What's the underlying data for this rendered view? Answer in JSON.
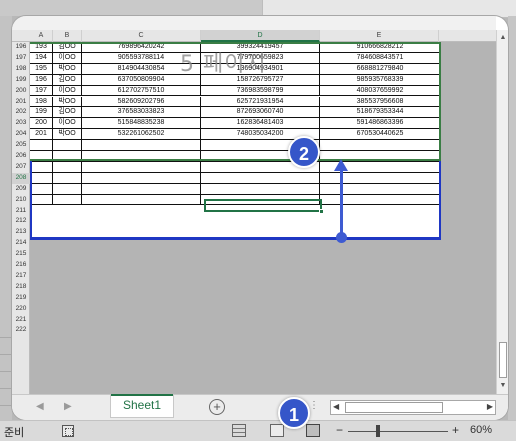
{
  "columns": [
    "A",
    "B",
    "C",
    "D",
    "E"
  ],
  "watermark": "5 페이지",
  "data_rows": [
    {
      "row": "196",
      "a": "193",
      "b": "김OO",
      "c": "769896420242",
      "d": "399324419457",
      "e": "910666828212"
    },
    {
      "row": "197",
      "a": "194",
      "b": "이OO",
      "c": "905593788114",
      "d": "779700659823",
      "e": "784608843571"
    },
    {
      "row": "198",
      "a": "195",
      "b": "박OO",
      "c": "814904430854",
      "d": "136904934901",
      "e": "668881279840"
    },
    {
      "row": "199",
      "a": "196",
      "b": "김OO",
      "c": "637050809904",
      "d": "158726795727",
      "e": "985935768339"
    },
    {
      "row": "200",
      "a": "197",
      "b": "이OO",
      "c": "612702757510",
      "d": "736983598799",
      "e": "408037659992"
    },
    {
      "row": "201",
      "b": "박OO",
      "a": "198",
      "c": "582609202796",
      "d": "625721931954",
      "e": "385537956608"
    },
    {
      "row": "202",
      "a": "199",
      "b": "김OO",
      "c": "376583033823",
      "d": "872693060740",
      "e": "518679353344"
    },
    {
      "row": "203",
      "a": "200",
      "b": "이OO",
      "c": "515848835238",
      "d": "162836481403",
      "e": "591486863396"
    },
    {
      "row": "204",
      "a": "201",
      "b": "박OO",
      "c": "532261062502",
      "d": "748035034200",
      "e": "670530440625"
    }
  ],
  "empty_rows": [
    "205",
    "206",
    "207",
    "208",
    "209",
    "210"
  ],
  "gray_rows": [
    "211",
    "212",
    "213",
    "214",
    "215",
    "216",
    "217",
    "218",
    "219",
    "220",
    "221",
    "222"
  ],
  "active_row": "208",
  "active_column": "D",
  "sheet_tab": "Sheet1",
  "status": {
    "ready_text": "준비",
    "zoom": "60%"
  },
  "badges": {
    "one": "1",
    "two": "2"
  },
  "colors": {
    "excel_green": "#217346",
    "print_area_blue": "#1f37c3",
    "callout_blue": "#3556c9"
  }
}
